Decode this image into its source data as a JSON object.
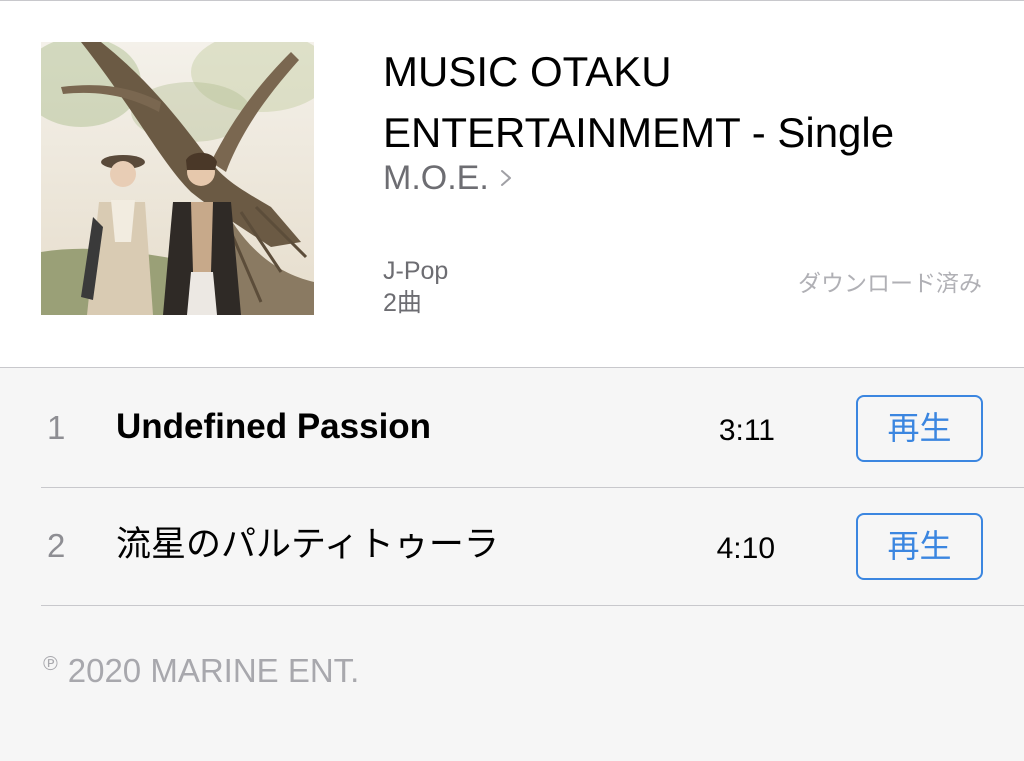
{
  "album": {
    "title_line1": "MUSIC OTAKU",
    "title_line2": "ENTERTAINMEMT - Single",
    "artist": "M.O.E.",
    "genre": "J-Pop",
    "track_count": "2曲",
    "status": "ダウンロード済み",
    "artwork_icon": "album-artwork"
  },
  "tracks": [
    {
      "number": "1",
      "title": "Undefined Passion",
      "duration": "3:11",
      "action": "再生"
    },
    {
      "number": "2",
      "title": "流星のパルティトゥーラ",
      "duration": "4:10",
      "action": "再生"
    }
  ],
  "footer": {
    "phonogram_mark": "℗",
    "copyright": "2020 MARINE ENT."
  },
  "colors": {
    "accent": "#3b86e0",
    "secondary_text": "#6d6d72",
    "muted_text": "#a8a8ad",
    "list_background": "#f6f6f6",
    "separator": "#c8c8cc"
  }
}
